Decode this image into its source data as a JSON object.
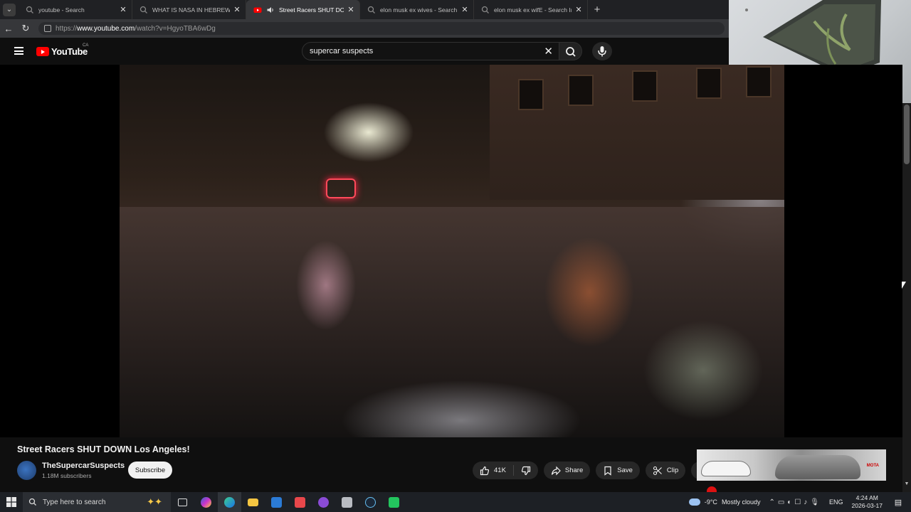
{
  "browser": {
    "tabs": [
      {
        "title": "youtube - Search",
        "active": false
      },
      {
        "title": "WHAT IS NASA IN HEBREW - Sear",
        "active": false
      },
      {
        "title": "Street Racers SHUT DOWN Lo",
        "active": true
      },
      {
        "title": "elon musk ex wives - Search",
        "active": false
      },
      {
        "title": "elon musk ex wifE - Search Image",
        "active": false
      }
    ],
    "url_prefix": "https://",
    "url_host": "www.youtube.com",
    "url_path": "/watch?v=HgyoTBA6wDg"
  },
  "youtube": {
    "logo_text": "YouTube",
    "country_code": "CA",
    "search_query": "supercar suspects",
    "video_title": "Street Racers SHUT DOWN Los Angeles!",
    "channel_name": "TheSupercarSuspects",
    "channel_subscribers": "1.18M subscribers",
    "subscribe_label": "Subscribe",
    "like_count": "41K",
    "share_label": "Share",
    "save_label": "Save",
    "clip_label": "Clip",
    "more_label": "⋯",
    "thumb_tag": "MOTA"
  },
  "taskbar": {
    "search_placeholder": "Type here to search",
    "temperature": "-9°C",
    "weather": "Mostly cloudy",
    "language": "ENG",
    "time": "4:24 AM",
    "date": "2026-03-17"
  },
  "colors": {
    "yt_red": "#ff0000",
    "page_bg": "#0f0f0f",
    "taskbar_bg": "#1d2025"
  }
}
